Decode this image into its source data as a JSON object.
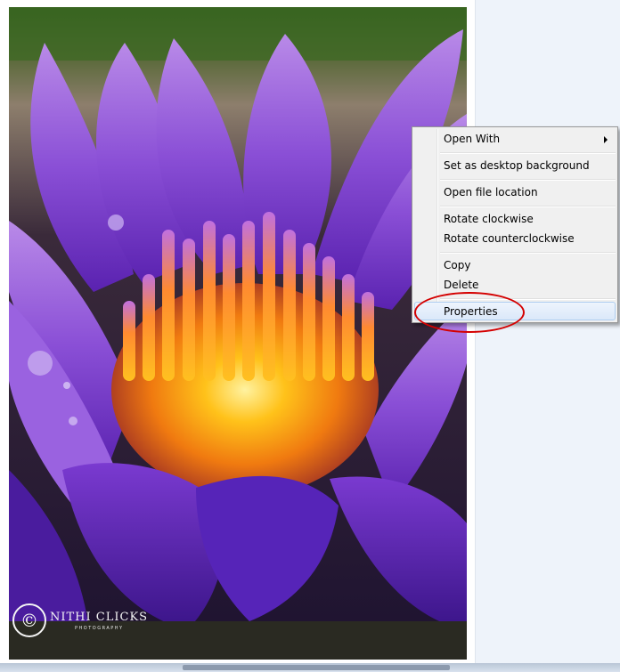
{
  "viewer": {
    "photo": {
      "subject": "purple-water-lily",
      "watermark": {
        "title": "NITHI CLICKS",
        "subtitle": "PHOTOGRAPHY",
        "icon": "camera-aperture-copyright-icon"
      }
    }
  },
  "context_menu": {
    "items": [
      {
        "label": "Open With",
        "has_submenu": true,
        "icon": "chevron-right-icon"
      },
      {
        "label": "Set as desktop background"
      },
      {
        "label": "Open file location"
      },
      {
        "label": "Rotate clockwise"
      },
      {
        "label": "Rotate counterclockwise"
      },
      {
        "label": "Copy"
      },
      {
        "label": "Delete"
      },
      {
        "label": "Properties",
        "highlighted": true
      }
    ]
  },
  "annotation": {
    "color": "#d40000",
    "target": "Properties"
  },
  "colors": {
    "menu_background": "#f0f0f0",
    "menu_border": "#979797",
    "highlight_border": "#aecdf0",
    "pane_background": "#eef3fa"
  }
}
